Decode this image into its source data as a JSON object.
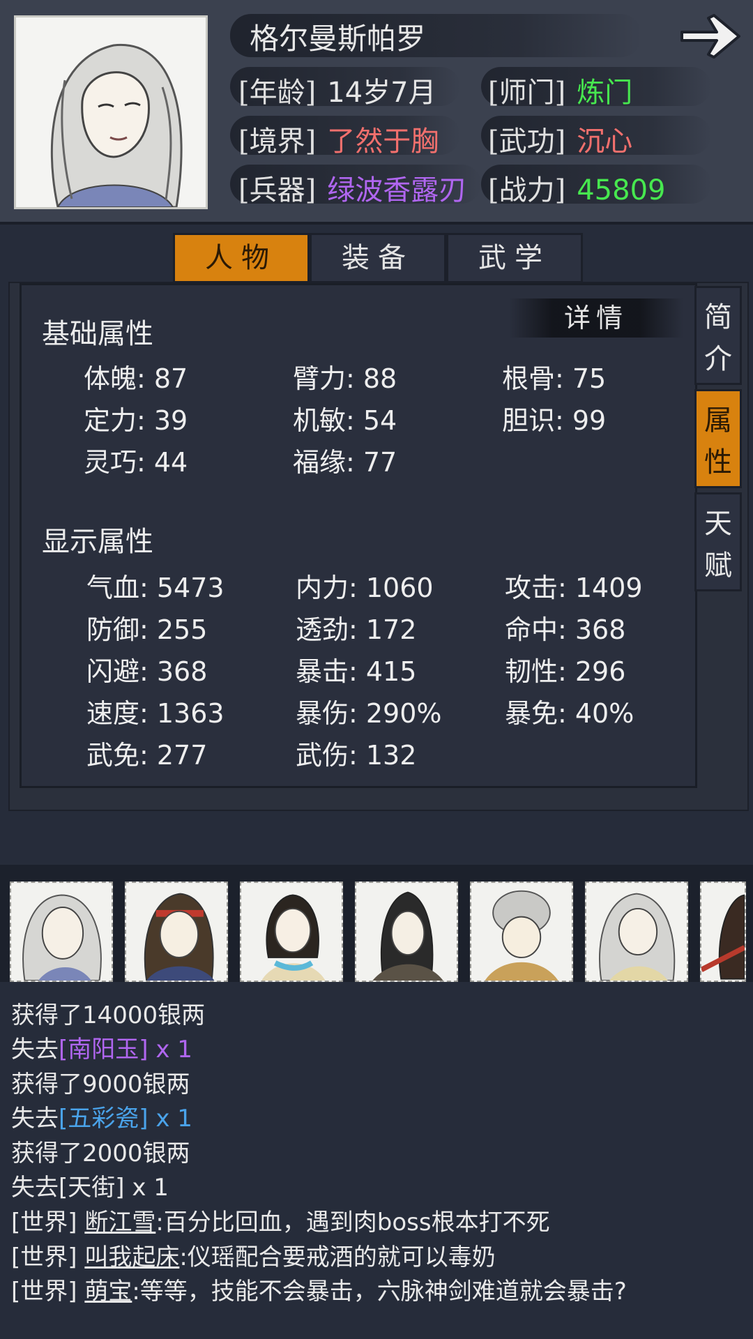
{
  "character": {
    "name": "格尔曼斯帕罗",
    "age_label": "[年龄]",
    "age": "14岁7月",
    "sect_label": "[师门]",
    "sect": "炼门",
    "realm_label": "[境界]",
    "realm": "了然于胸",
    "skill_label": "[武功]",
    "skill": "沉心",
    "weapon_label": "[兵器]",
    "weapon": "绿波香露刃",
    "power_label": "[战力]",
    "power": "45809"
  },
  "colors": {
    "accent": "#d8820f",
    "green": "#47e84f",
    "red": "#f2706d",
    "purple": "#b066f0",
    "blue": "#4aa3ea"
  },
  "tabs": [
    {
      "label": "人物",
      "active": true
    },
    {
      "label": "装备",
      "active": false
    },
    {
      "label": "武学",
      "active": false
    }
  ],
  "side_tabs": [
    {
      "c1": "简",
      "c2": "介",
      "active": false
    },
    {
      "c1": "属",
      "c2": "性",
      "active": true
    },
    {
      "c1": "天",
      "c2": "赋",
      "active": false
    }
  ],
  "detail_button": "详情",
  "base_attrs": {
    "title": "基础属性",
    "items": [
      "体魄: 87",
      "臂力: 88",
      "根骨: 75",
      "定力: 39",
      "机敏: 54",
      "胆识: 99",
      "灵巧: 44",
      "福缘: 77"
    ]
  },
  "display_attrs": {
    "title": "显示属性",
    "items": [
      "气血: 5473",
      "内力: 1060",
      "攻击: 1409",
      "防御: 255",
      "透劲: 172",
      "命中: 368",
      "闪避: 368",
      "暴击: 415",
      "韧性: 296",
      "速度: 1363",
      "暴伤: 290%",
      "暴免: 40%",
      "武免: 277",
      "武伤: 132"
    ]
  },
  "log": {
    "l1": "获得了14000银两",
    "l2a": "失去",
    "l2b": "[南阳玉]",
    "l2c": " x 1",
    "l3": "获得了9000银两",
    "l4a": "失去",
    "l4b": "[五彩瓷]",
    "l4c": " x 1",
    "l5": "获得了2000银两",
    "l6": "失去[天街] x 1",
    "l7a": "[世界] ",
    "l7b": "断江雪",
    "l7c": ":百分比回血，遇到肉boss根本打不死",
    "l8a": "[世界] ",
    "l8b": "叫我起床",
    "l8c": ":仪瑶配合要戒酒的就可以毒奶",
    "l9a": "[世界] ",
    "l9b": "萌宝",
    "l9c": ":等等，技能不会暴击，六脉神剑难道就会暴击?"
  }
}
